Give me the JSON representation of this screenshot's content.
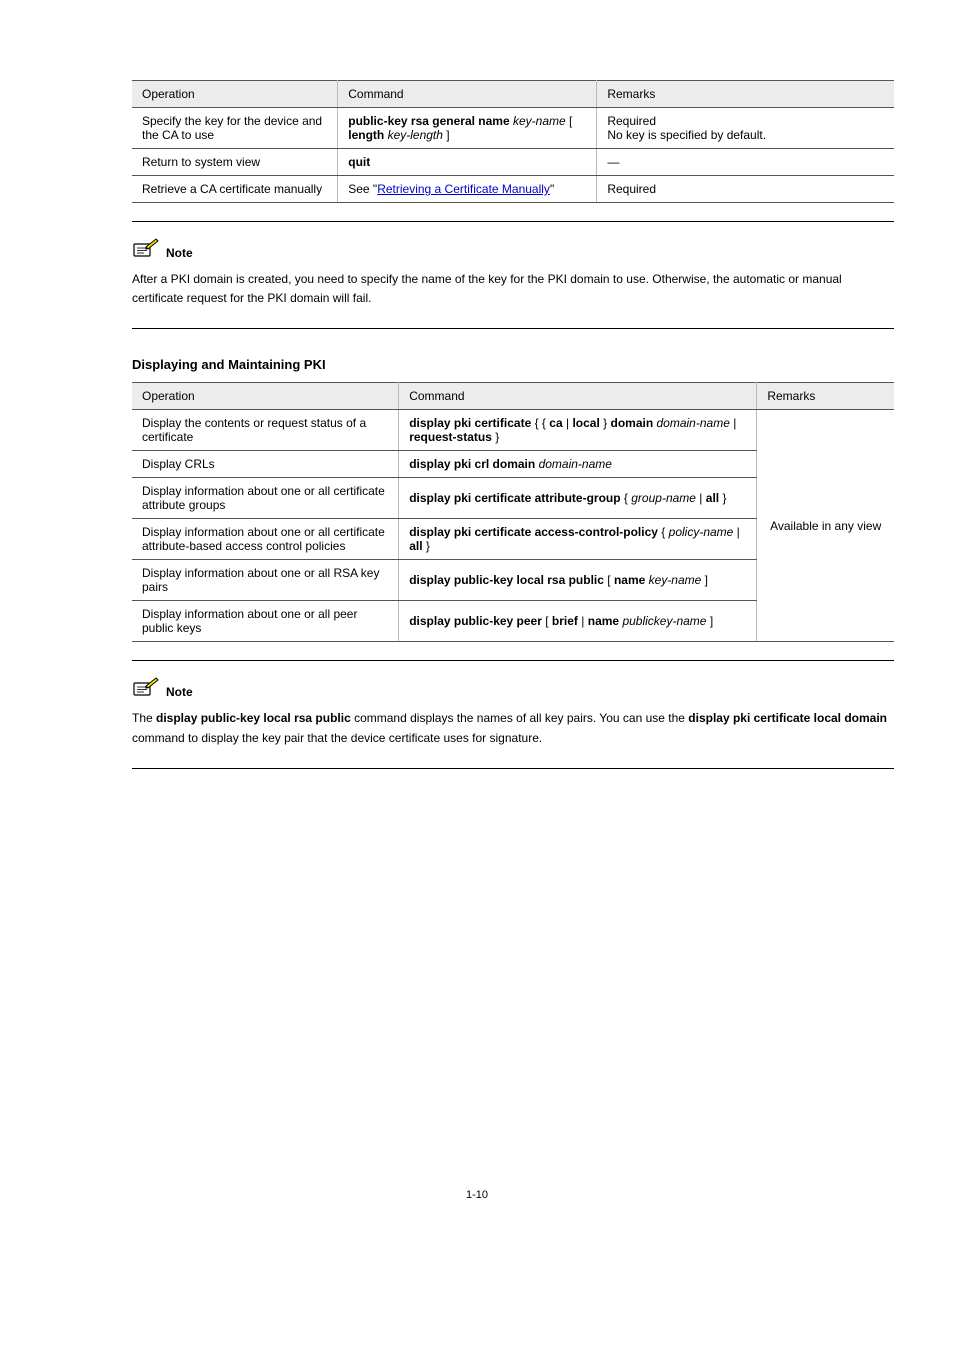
{
  "table1": {
    "headers": [
      "Operation",
      "Command",
      "Remarks"
    ],
    "rows": [
      [
        "Specify the key for the device and the CA to use",
        "public-key rsa general name key-name [ length key-length ]",
        "Required\nNo key is specified by default."
      ],
      [
        "Return to system view",
        "quit",
        "—"
      ],
      [
        "Retrieve a CA certificate manually",
        "See \"Retrieving a Certificate Manually\"",
        "Required"
      ]
    ]
  },
  "note1": {
    "label": "Note",
    "text": "After a PKI domain is created, you need to specify the name of the key for the PKI domain to use. Otherwise, the automatic or manual certificate request for the PKI domain will fail."
  },
  "section_title": "Displaying and Maintaining PKI",
  "table2": {
    "headers": [
      "Operation",
      "Command",
      "Remarks"
    ],
    "rows": [
      [
        "Display the contents or request status of a certificate",
        "display pki certificate { { ca | local } domain domain-name | request-status }",
        ""
      ],
      [
        "Display CRLs",
        "display pki crl domain domain-name",
        ""
      ],
      [
        "Display information about one or all certificate attribute groups",
        "display pki certificate attribute-group { group-name | all }",
        ""
      ],
      [
        "Display information about one or all certificate attribute-based access control policies",
        "display pki certificate access-control-policy { policy-name | all }",
        ""
      ],
      [
        "Display information about one or all RSA key pairs",
        "display public-key local rsa public [ name key-name ]",
        ""
      ],
      [
        "Display information about one or all peer public keys",
        "display public-key peer [ brief | name publickey-name ]",
        ""
      ]
    ],
    "remarks_all": "Available in any view"
  },
  "note2": {
    "label": "Note",
    "text": "The display public-key local rsa public command displays the names of all key pairs. You can use the display pki certificate local domain command to display the key pair that the device certificate uses for signature."
  },
  "page_number": "1-10"
}
